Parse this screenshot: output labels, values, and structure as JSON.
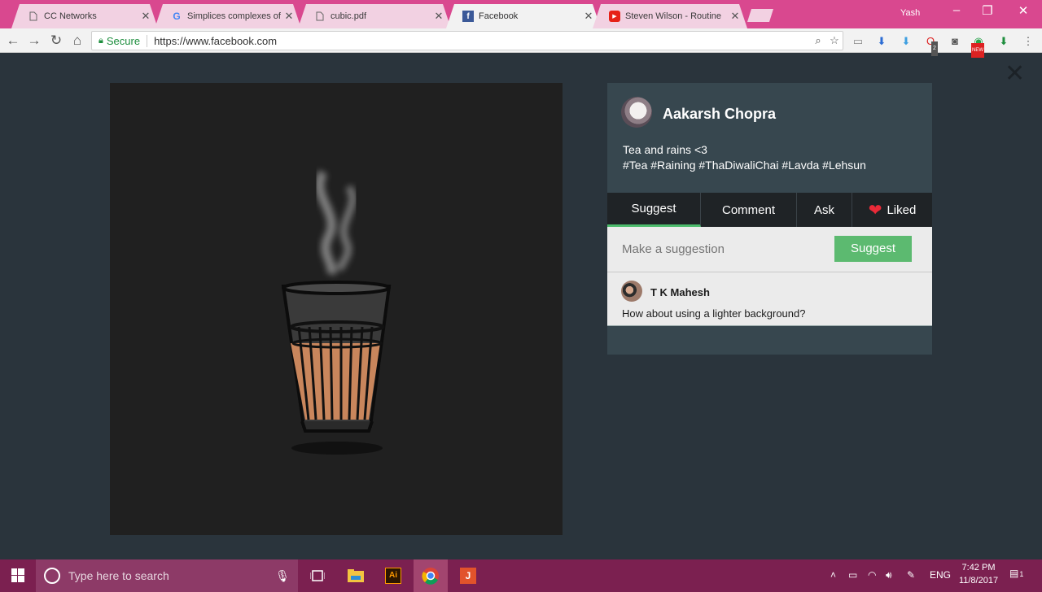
{
  "browser": {
    "tabs": [
      {
        "label": "CC Networks",
        "icon": "document-icon"
      },
      {
        "label": "Simplices complexes of g",
        "icon": "google-icon"
      },
      {
        "label": "cubic.pdf",
        "icon": "document-icon"
      },
      {
        "label": "Facebook",
        "icon": "facebook-icon",
        "active": true
      },
      {
        "label": "Steven Wilson - Routine",
        "icon": "youtube-icon"
      }
    ],
    "close_glyph": "✕",
    "user": "Yash",
    "secure_label": "Secure",
    "url": "https://www.facebook.com",
    "ext_badges": {
      "count": "2",
      "new": "NEW"
    }
  },
  "viewer": {
    "close_glyph": "✕",
    "post": {
      "author": "Aakarsh Chopra",
      "caption_line1": "Tea and rains <3",
      "caption_line2": "#Tea #Raining #ThaDiwaliChai #Lavda #Lehsun"
    },
    "tabs": {
      "suggest": "Suggest",
      "comment": "Comment",
      "ask": "Ask",
      "liked": "Liked"
    },
    "suggest_placeholder": "Make a suggestion",
    "suggest_button": "Suggest",
    "comment": {
      "author": "T K Mahesh",
      "text": "How about using a lighter background?"
    },
    "colors": {
      "accent": "#5cba70",
      "heart": "#ea2a38",
      "panel": "#37474f"
    }
  },
  "taskbar": {
    "search_placeholder": "Type here to search",
    "language": "ENG",
    "time": "7:42 PM",
    "date": "11/8/2017",
    "notification_count": "1"
  }
}
